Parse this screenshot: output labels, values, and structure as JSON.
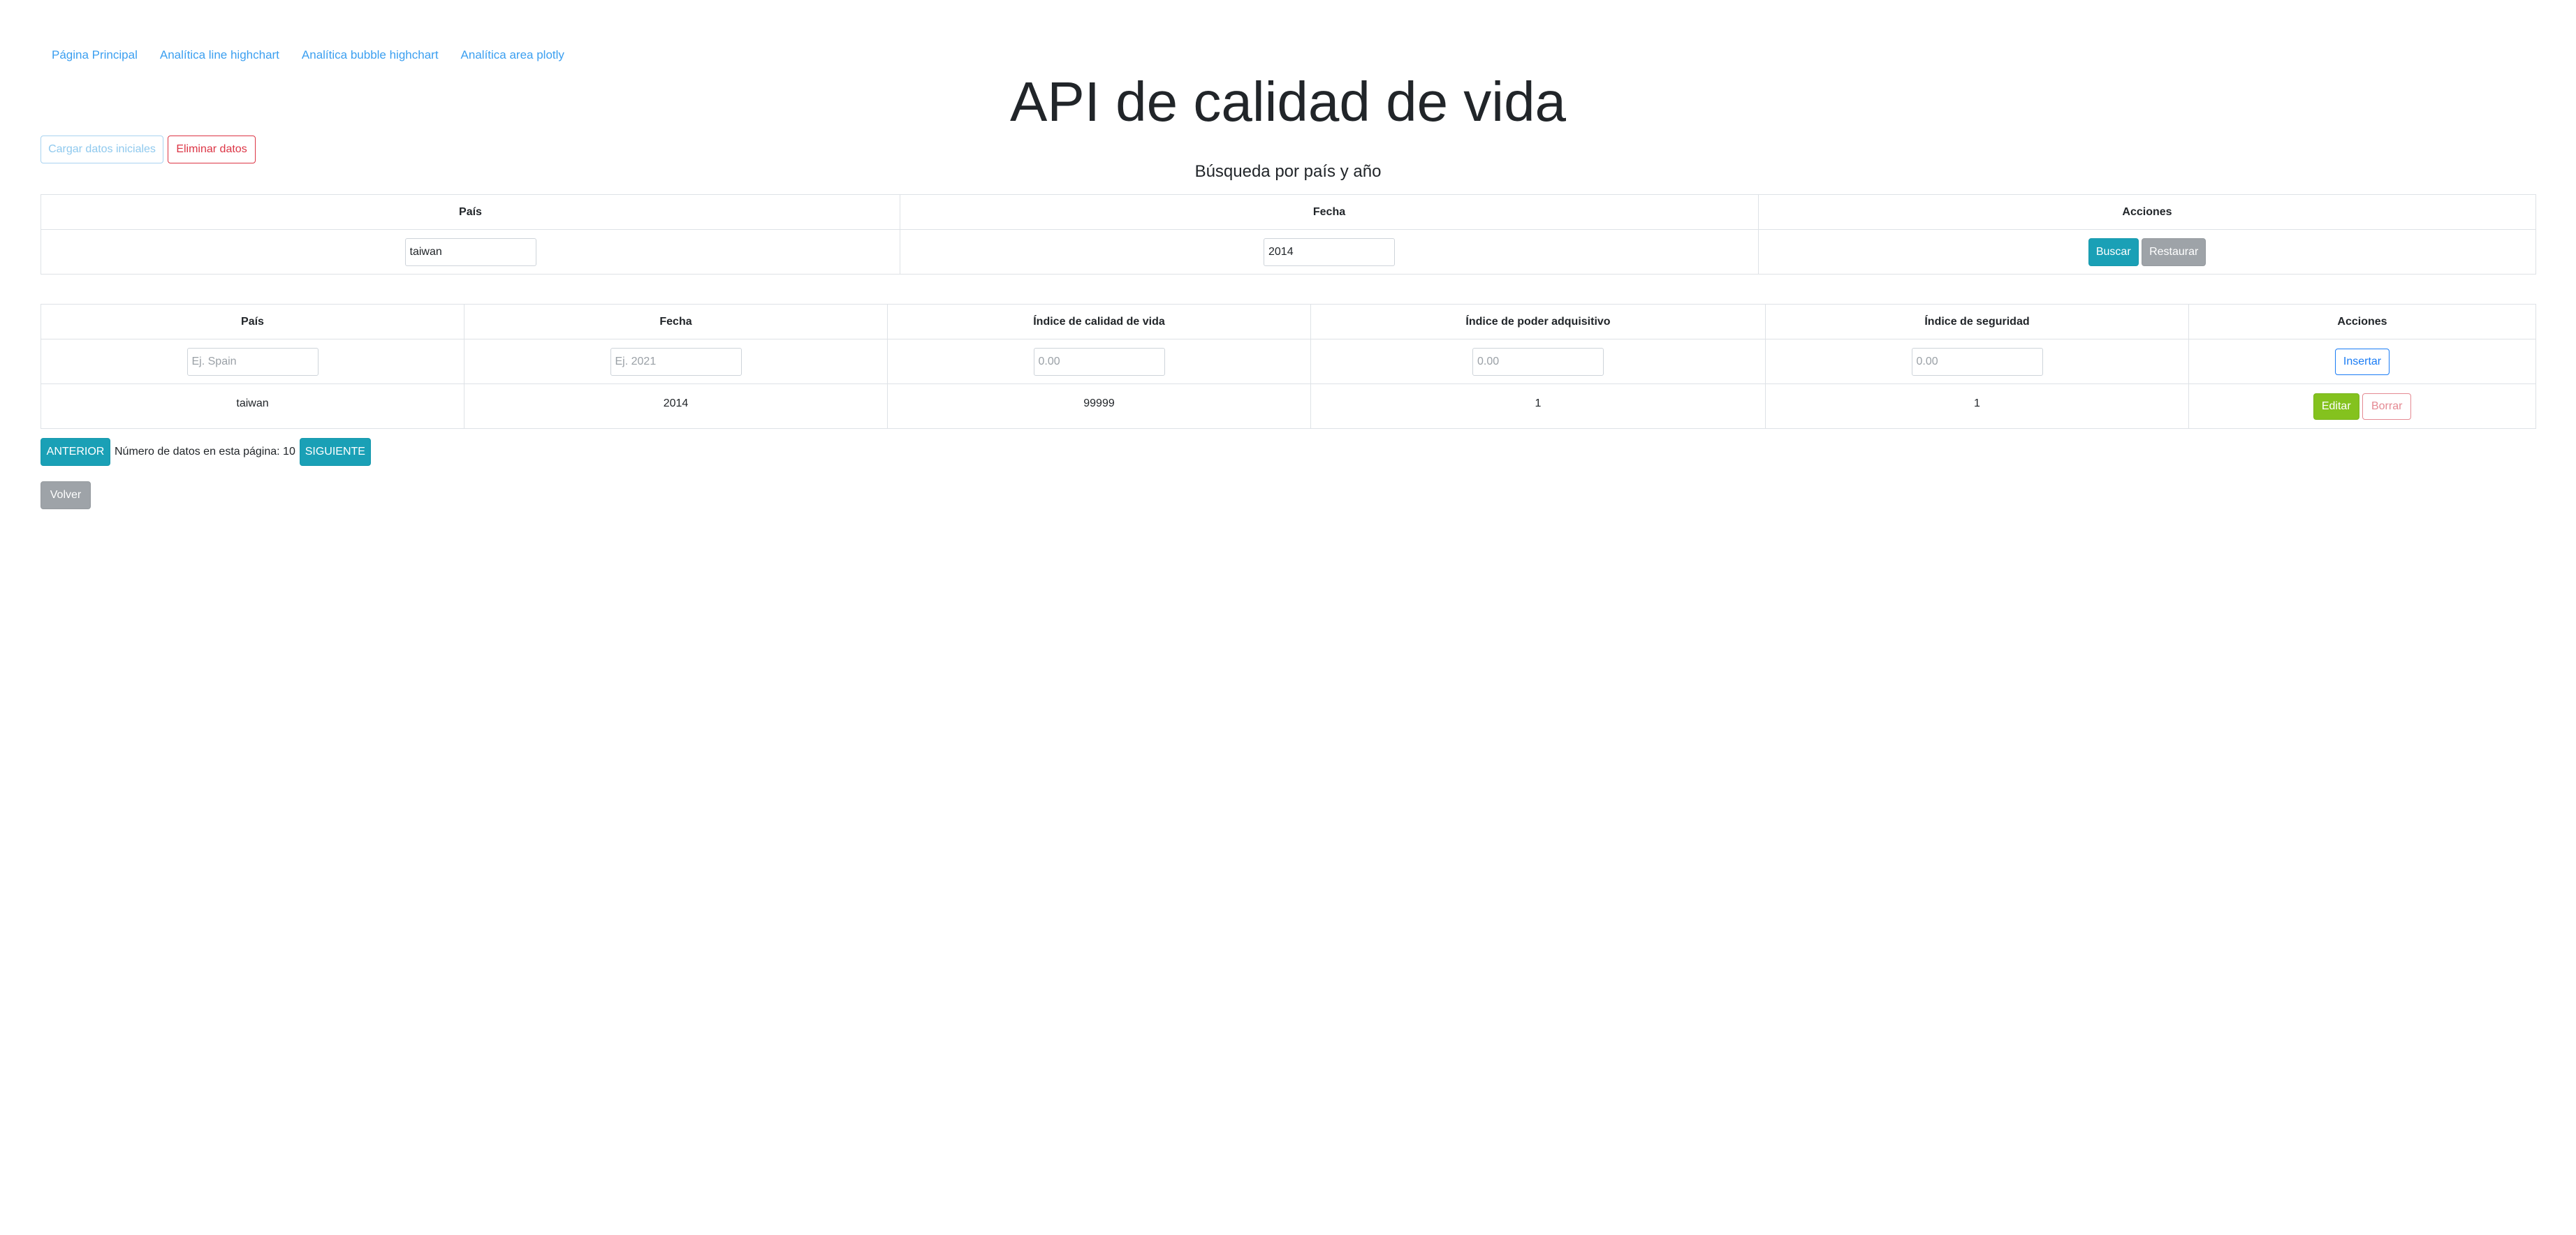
{
  "nav": {
    "links": [
      "Página Principal",
      "Analítica line highchart",
      "Analítica bubble highchart",
      "Analítica area plotly"
    ]
  },
  "page_title": "API de calidad de vida",
  "actions": {
    "load_label": "Cargar datos iniciales",
    "delete_label": "Eliminar datos"
  },
  "search": {
    "heading": "Búsqueda por país y año",
    "headers": [
      "País",
      "Fecha",
      "Acciones"
    ],
    "country_value": "taiwan",
    "year_value": "2014",
    "search_label": "Buscar",
    "reset_label": "Restaurar"
  },
  "table": {
    "headers": [
      "País",
      "Fecha",
      "Índice de calidad de vida",
      "Índice de poder adquisitivo",
      "Índice de seguridad",
      "Acciones"
    ],
    "placeholders": {
      "country": "Ej. Spain",
      "year": "Ej. 2021",
      "quality": "0.00",
      "purchasing": "0.00",
      "safety": "0.00"
    },
    "insert_label": "Insertar",
    "rows": [
      {
        "country": "taiwan",
        "year": "2014",
        "quality": "99999",
        "purchasing": "1",
        "safety": "1",
        "edit_label": "Editar",
        "delete_label": "Borrar"
      }
    ]
  },
  "pagination": {
    "prev_label": "ANTERIOR",
    "count_text": "Número de datos en esta página: 10",
    "next_label": "SIGUIENTE"
  },
  "back_label": "Volver",
  "colors": {
    "link": "#3b9ff0",
    "info": "#1aa0b6",
    "danger": "#dc3545",
    "success": "#84c21e",
    "secondary": "#9ea3a8",
    "primary": "#1a7cf5"
  }
}
